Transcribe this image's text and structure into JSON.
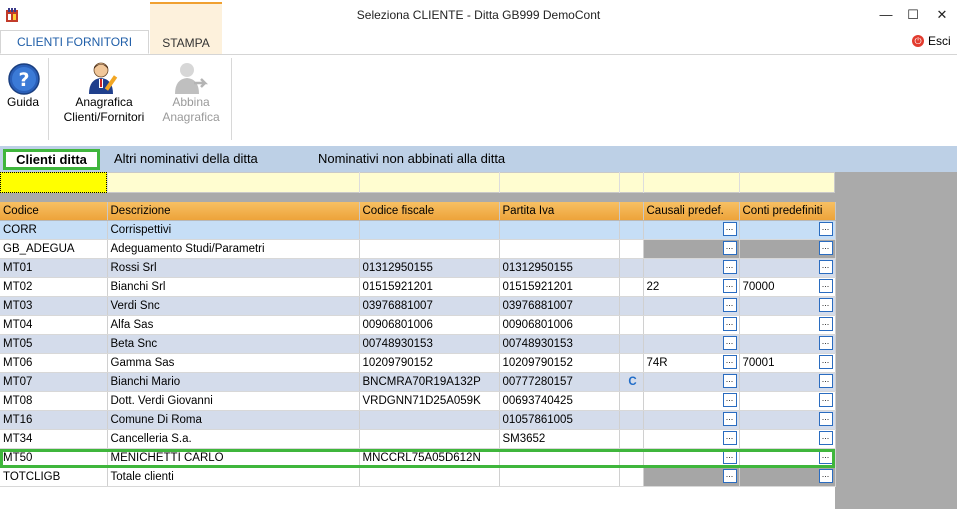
{
  "window": {
    "title": "Seleziona CLIENTE  - Ditta GB999 DemoCont",
    "controls": [
      "—",
      "☐",
      "✕"
    ]
  },
  "ribbon_tabs": [
    {
      "label": "CLIENTI FORNITORI"
    },
    {
      "label": "STAMPA"
    }
  ],
  "esci": {
    "label": "Esci"
  },
  "ribbon": {
    "guida": {
      "label": "Guida"
    },
    "anagrafica": {
      "label_line1": "Anagrafica",
      "label_line2": "Clienti/Fornitori"
    },
    "abbina": {
      "label_line1": "Abbina",
      "label_line2": "Anagrafica"
    }
  },
  "subtabs": {
    "active": "Clienti ditta",
    "others": [
      "Altri nominativi della ditta",
      "Nominativi non abbinati alla ditta"
    ]
  },
  "table": {
    "columns": [
      "Codice",
      "Descrizione",
      "Codice fiscale",
      "Partita Iva",
      "",
      "Causali predef.",
      "Conti predefiniti"
    ],
    "rows": [
      {
        "codice": "CORR",
        "descrizione": "Corrispettivi",
        "cf": "",
        "piva": "",
        "flag": "",
        "causali": "",
        "conti": ""
      },
      {
        "codice": "GB_ADEGUA",
        "descrizione": "Adeguamento Studi/Parametri",
        "cf": "",
        "piva": "",
        "flag": "",
        "causali": "",
        "conti": ""
      },
      {
        "codice": "MT01",
        "descrizione": "Rossi Srl",
        "cf": "01312950155",
        "piva": "01312950155",
        "flag": "",
        "causali": "",
        "conti": ""
      },
      {
        "codice": "MT02",
        "descrizione": "Bianchi Srl",
        "cf": "01515921201",
        "piva": "01515921201",
        "flag": "",
        "causali": "22",
        "conti": "70000"
      },
      {
        "codice": "MT03",
        "descrizione": "Verdi Snc",
        "cf": "03976881007",
        "piva": "03976881007",
        "flag": "",
        "causali": "",
        "conti": ""
      },
      {
        "codice": "MT04",
        "descrizione": "Alfa Sas",
        "cf": "00906801006",
        "piva": "00906801006",
        "flag": "",
        "causali": "",
        "conti": ""
      },
      {
        "codice": "MT05",
        "descrizione": "Beta Snc",
        "cf": "00748930153",
        "piva": "00748930153",
        "flag": "",
        "causali": "",
        "conti": ""
      },
      {
        "codice": "MT06",
        "descrizione": "Gamma Sas",
        "cf": "10209790152",
        "piva": "10209790152",
        "flag": "",
        "causali": "74R",
        "conti": "70001"
      },
      {
        "codice": "MT07",
        "descrizione": "Bianchi Mario",
        "cf": "BNCMRA70R19A132P",
        "piva": "00777280157",
        "flag": "C",
        "causali": "",
        "conti": ""
      },
      {
        "codice": "MT08",
        "descrizione": "Dott. Verdi Giovanni",
        "cf": "VRDGNN71D25A059K",
        "piva": "00693740425",
        "flag": "",
        "causali": "",
        "conti": ""
      },
      {
        "codice": "MT16",
        "descrizione": "Comune Di Roma",
        "cf": "",
        "piva": "01057861005",
        "flag": "",
        "causali": "",
        "conti": ""
      },
      {
        "codice": "MT34",
        "descrizione": "Cancelleria S.a.",
        "cf": "",
        "piva": "SM3652",
        "flag": "",
        "causali": "",
        "conti": ""
      },
      {
        "codice": "MT50",
        "descrizione": "MENICHETTI CARLO",
        "cf": "MNCCRL75A05D612N",
        "piva": "",
        "flag": "",
        "causali": "",
        "conti": ""
      },
      {
        "codice": "TOTCLIGB",
        "descrizione": "Totale clienti",
        "cf": "",
        "piva": "",
        "flag": "",
        "causali": "",
        "conti": ""
      }
    ],
    "ellipsis_label": "..."
  },
  "colors": {
    "accent": "#1f5ea8",
    "highlight_frame": "#3fb63c",
    "header_orange": "#f0b050",
    "filter_yellow": "#ffff00"
  }
}
